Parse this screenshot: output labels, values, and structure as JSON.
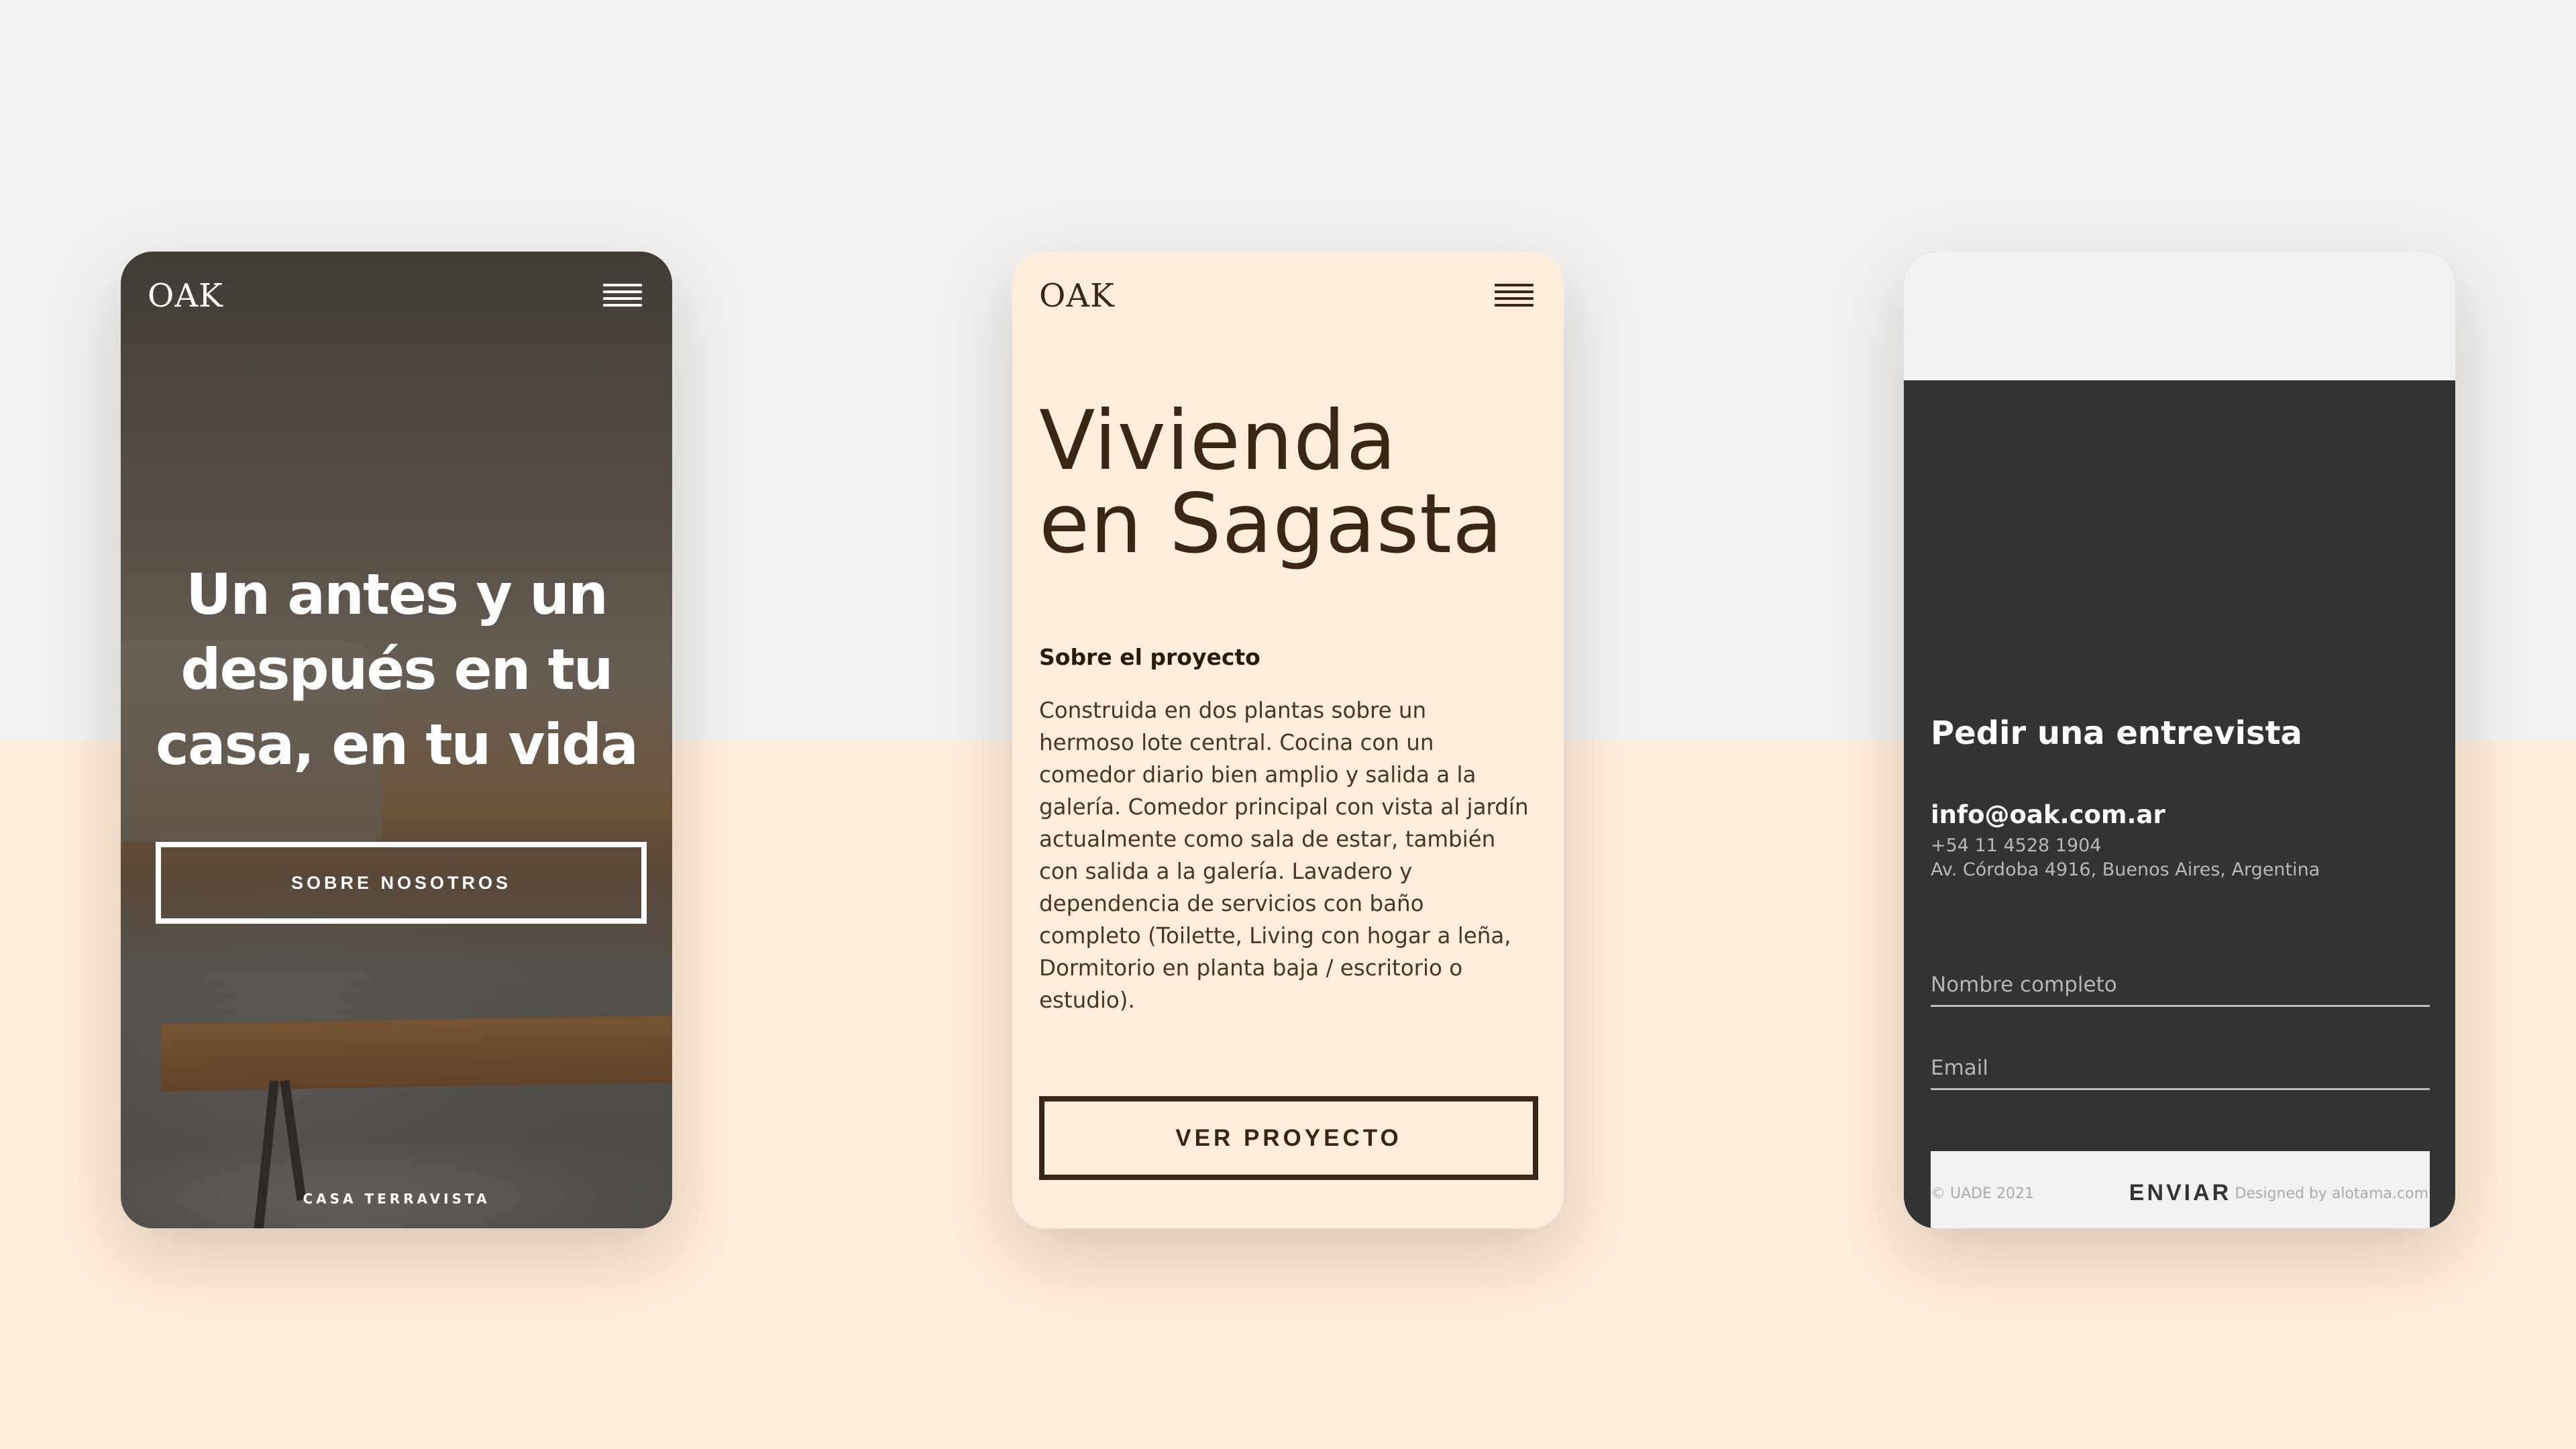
{
  "colors": {
    "page_top": "#f2f2f2",
    "page_bottom": "#ffeedb",
    "brown": "#3a2612",
    "dark_panel": "#333333",
    "white": "#ffffff"
  },
  "screen_home": {
    "logo": "OAK",
    "menu_icon": "hamburger-icon",
    "hero_line_1": "Un antes y un",
    "hero_line_2": "después en tu",
    "hero_line_3": "casa, en tu vida",
    "button_label": "SOBRE NOSOTROS",
    "footer_label": "CASA TERRAVISTA"
  },
  "screen_project": {
    "logo": "OAK",
    "menu_icon": "hamburger-icon",
    "title_line_1": "Vivienda",
    "title_line_2": "en Sagasta",
    "subtitle": "Sobre el proyecto",
    "body_lines": [
      "Construida en dos plantas sobre un",
      "hermoso lote central. Cocina con un",
      "comedor diario bien amplio y salida a la",
      "galería. Comedor principal con vista al jardín",
      "actualmente como sala de estar, también",
      "con salida a la galería. Lavadero y",
      "dependencia de servicios con baño",
      "completo (Toilette, Living con hogar a leña,",
      "Dormitorio en planta baja / escritorio o",
      "estudio)."
    ],
    "button_label": "VER PROYECTO"
  },
  "screen_contact": {
    "heading": "Pedir una entrevista",
    "email": "info@oak.com.ar",
    "phone": "+54 11 4528 1904",
    "address": "Av. Córdoba 4916, Buenos Aires, Argentina",
    "name_placeholder": "Nombre completo",
    "email_placeholder": "Email",
    "submit_label": "ENVIAR",
    "copyright": "© UADE 2021",
    "credit": "Designed by alotama.com"
  }
}
